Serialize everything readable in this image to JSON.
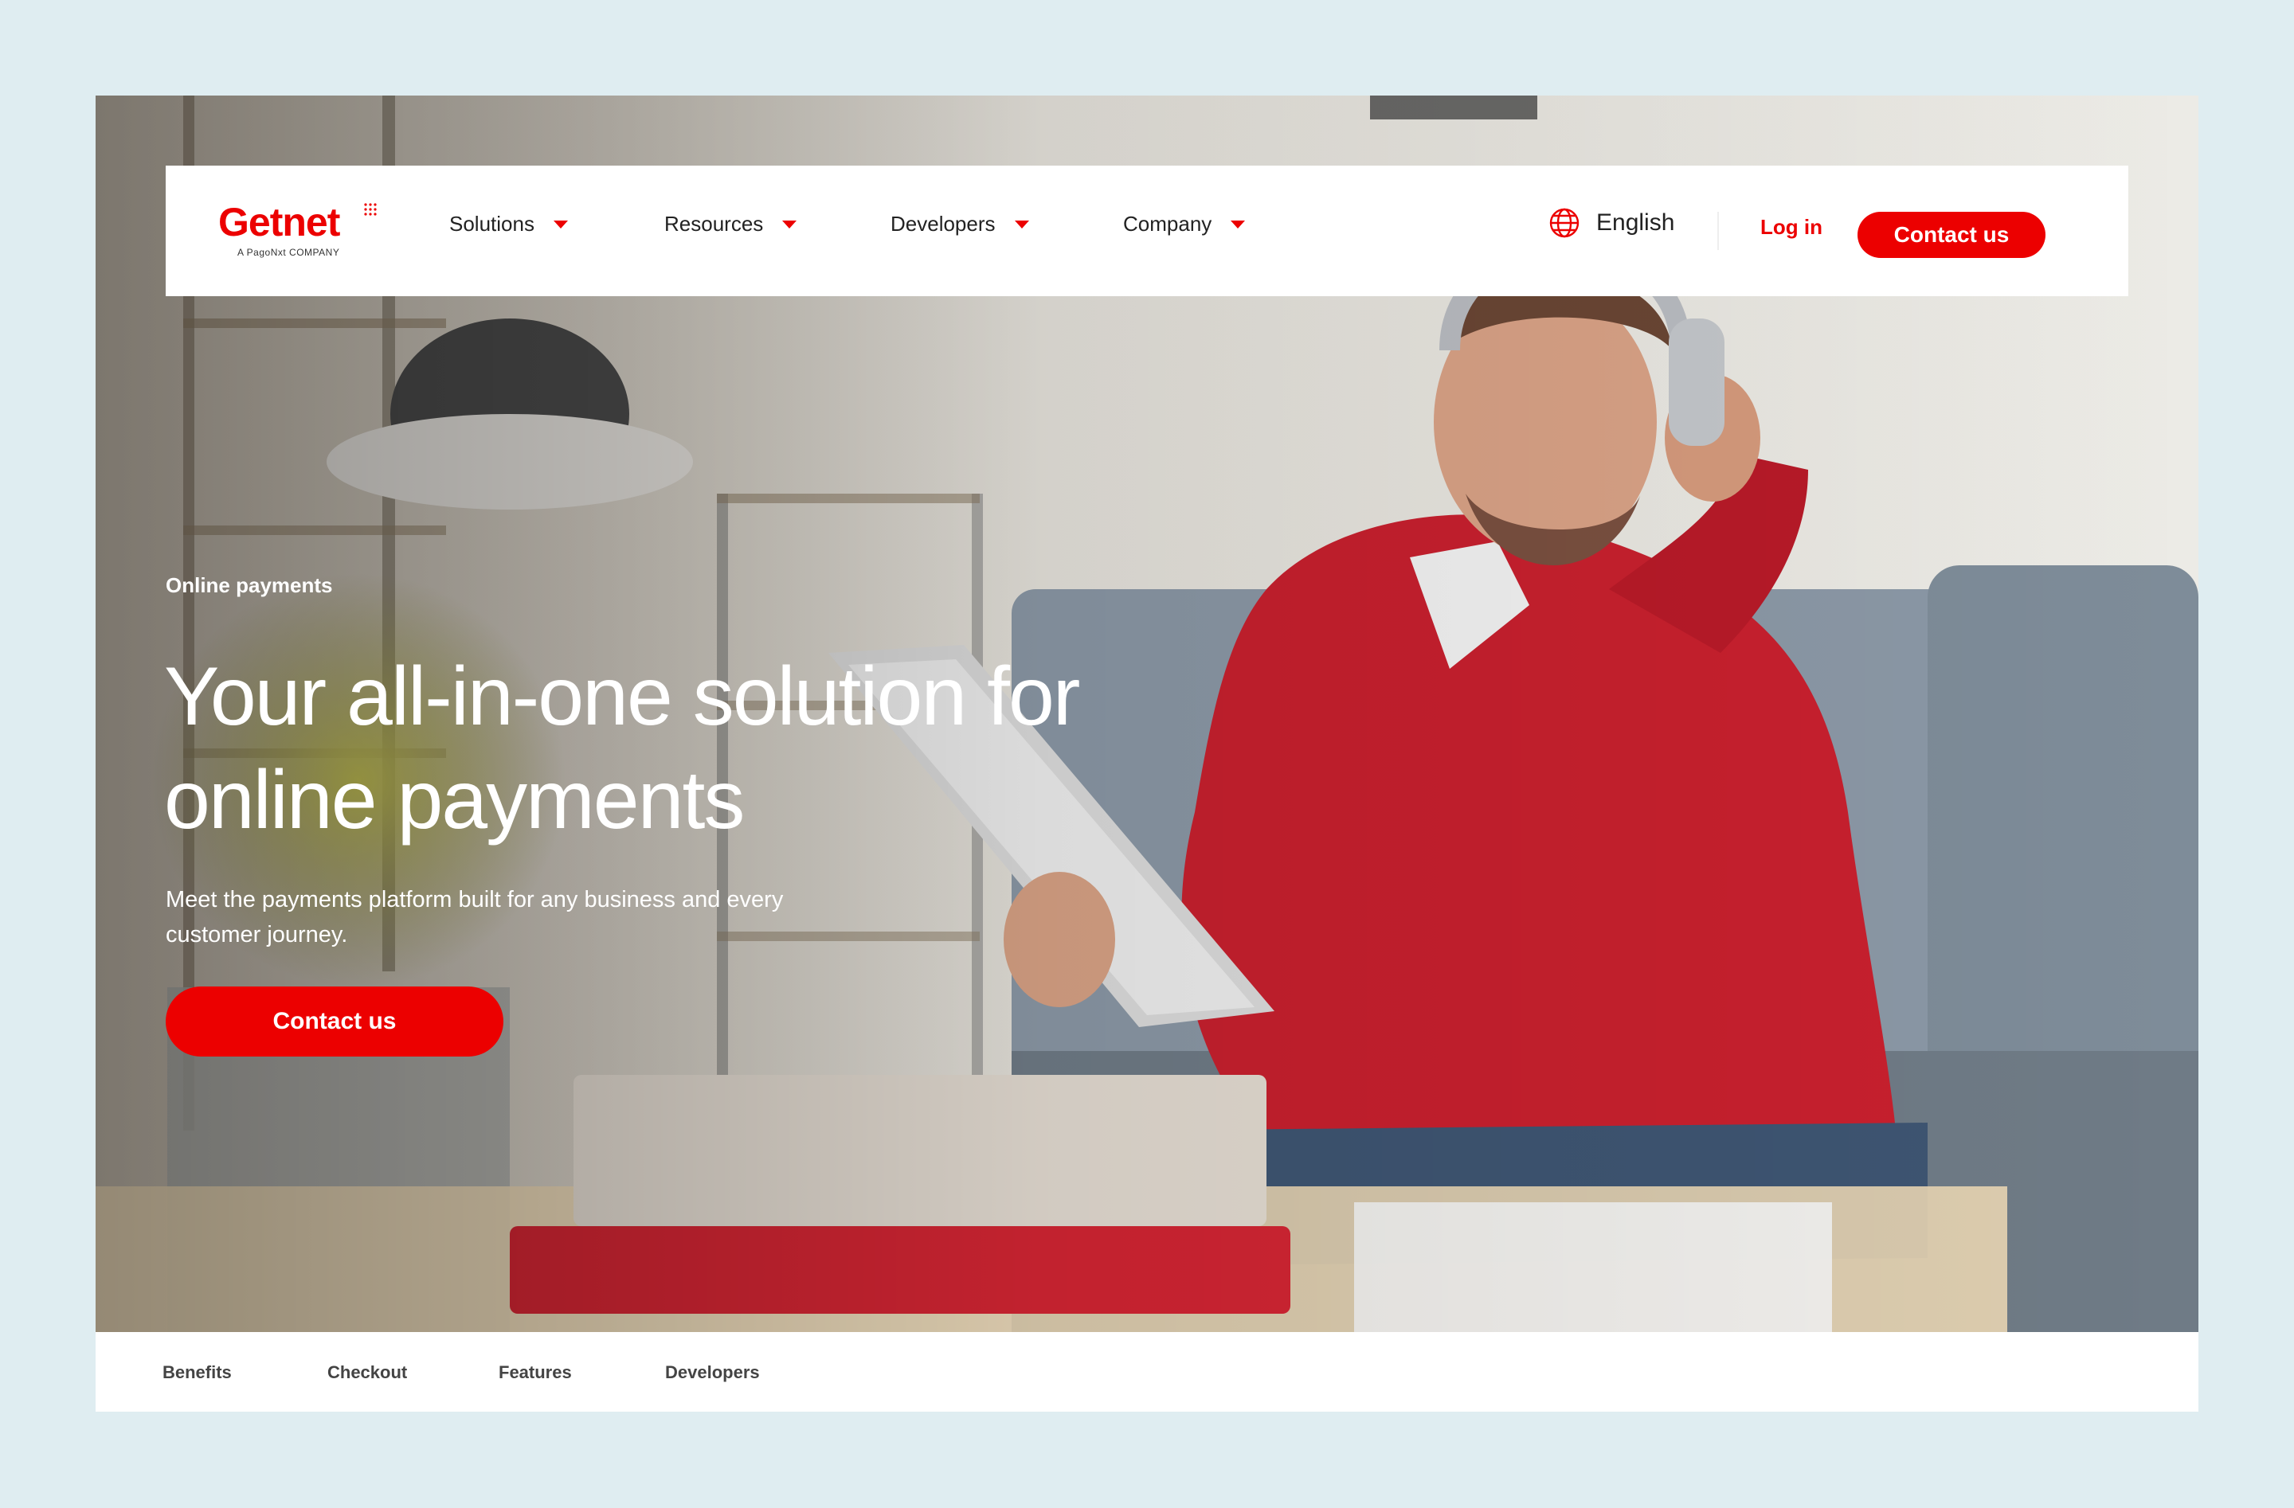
{
  "brand": {
    "name": "Getnet",
    "tagline": "A PagoNxt COMPANY",
    "primary_color": "#ec0000"
  },
  "nav": {
    "items": [
      {
        "label": "Solutions"
      },
      {
        "label": "Resources"
      },
      {
        "label": "Developers"
      },
      {
        "label": "Company"
      }
    ],
    "language": "English",
    "login": "Log in",
    "contact": "Contact us"
  },
  "hero": {
    "eyebrow": "Online payments",
    "headline": "Your all-in-one solution for online payments",
    "subtext": "Meet the payments platform built for any business and every customer journey.",
    "cta": "Contact us"
  },
  "subnav": {
    "items": [
      {
        "label": "Benefits"
      },
      {
        "label": "Checkout"
      },
      {
        "label": "Features"
      },
      {
        "label": "Developers"
      }
    ]
  }
}
